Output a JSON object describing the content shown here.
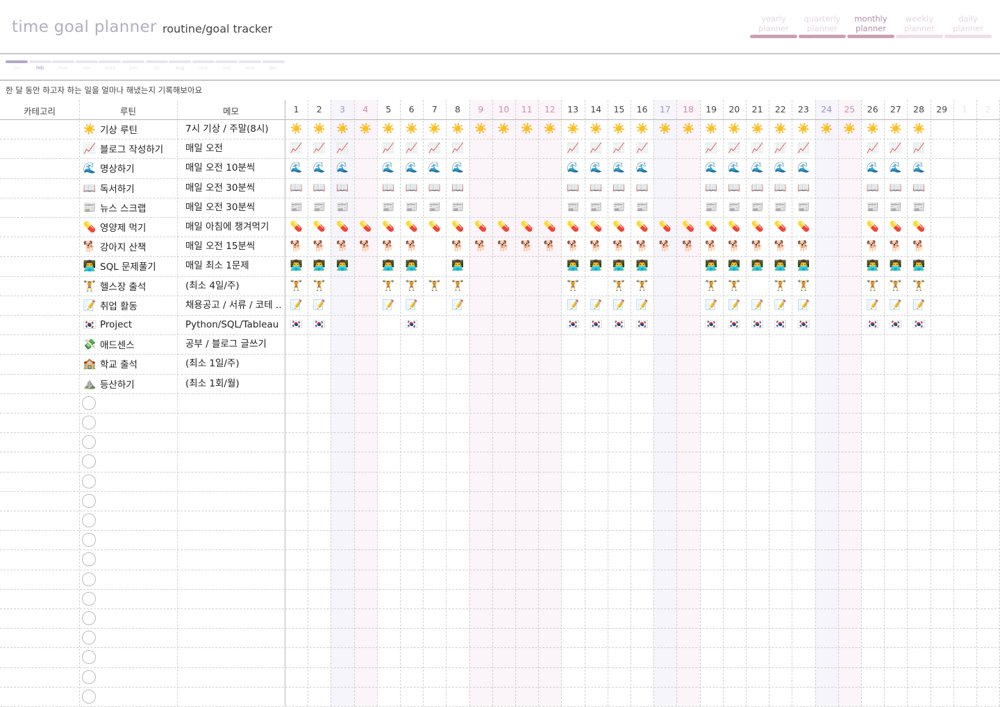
{
  "header": {
    "app_title": "time goal planner",
    "subtitle": "routine/goal tracker",
    "nav": [
      {
        "line1": "yearly",
        "line2": "planner",
        "state": "past"
      },
      {
        "line1": "quarterly",
        "line2": "planner",
        "state": "past"
      },
      {
        "line1": "monthly",
        "line2": "planner",
        "state": "active"
      },
      {
        "line1": "weekly",
        "line2": "planner",
        "state": "future"
      },
      {
        "line1": "daily",
        "line2": "planner",
        "state": "future"
      }
    ]
  },
  "months": [
    {
      "label": "jan",
      "state": "done"
    },
    {
      "label": "feb",
      "state": "current"
    },
    {
      "label": "mar",
      "state": "future"
    },
    {
      "label": "apr",
      "state": "future"
    },
    {
      "label": "may",
      "state": "future"
    },
    {
      "label": "jun",
      "state": "future"
    },
    {
      "label": "jul",
      "state": "future"
    },
    {
      "label": "aug",
      "state": "future"
    },
    {
      "label": "sep",
      "state": "future"
    },
    {
      "label": "oct",
      "state": "future"
    },
    {
      "label": "nov",
      "state": "future"
    },
    {
      "label": "dec",
      "state": "future"
    }
  ],
  "instruction": "한 달 동안 하고자 하는 일을 얼마나 해냈는지 기록해보아요",
  "columns": {
    "category": "카테고리",
    "routine": "루틴",
    "memo": "메모"
  },
  "days": [
    {
      "label": "1",
      "kind": "weekday"
    },
    {
      "label": "2",
      "kind": "weekday"
    },
    {
      "label": "3",
      "kind": "sat"
    },
    {
      "label": "4",
      "kind": "sun"
    },
    {
      "label": "5",
      "kind": "weekday"
    },
    {
      "label": "6",
      "kind": "weekday"
    },
    {
      "label": "7",
      "kind": "weekday"
    },
    {
      "label": "8",
      "kind": "weekday"
    },
    {
      "label": "9",
      "kind": "holiday"
    },
    {
      "label": "10",
      "kind": "holiday"
    },
    {
      "label": "11",
      "kind": "holiday"
    },
    {
      "label": "12",
      "kind": "holiday"
    },
    {
      "label": "13",
      "kind": "weekday"
    },
    {
      "label": "14",
      "kind": "weekday"
    },
    {
      "label": "15",
      "kind": "weekday"
    },
    {
      "label": "16",
      "kind": "weekday"
    },
    {
      "label": "17",
      "kind": "sat"
    },
    {
      "label": "18",
      "kind": "sun"
    },
    {
      "label": "19",
      "kind": "weekday"
    },
    {
      "label": "20",
      "kind": "weekday"
    },
    {
      "label": "21",
      "kind": "weekday"
    },
    {
      "label": "22",
      "kind": "weekday"
    },
    {
      "label": "23",
      "kind": "weekday"
    },
    {
      "label": "24",
      "kind": "sat"
    },
    {
      "label": "25",
      "kind": "sun"
    },
    {
      "label": "26",
      "kind": "weekday"
    },
    {
      "label": "27",
      "kind": "weekday"
    },
    {
      "label": "28",
      "kind": "weekday"
    },
    {
      "label": "29",
      "kind": "weekday"
    },
    {
      "label": "1",
      "kind": "next"
    },
    {
      "label": "2",
      "kind": "next"
    }
  ],
  "colors": {
    "sat_text": "#9c95c8",
    "sun_text": "#c890b4",
    "holiday_text": "#c890b4",
    "next_text": "#e6e6e6",
    "sat_bg": "#f6f5fb",
    "sun_bg": "#fbf4f8"
  },
  "routines": [
    {
      "icon": "☀️",
      "name": "기상 루틴",
      "memo": "7시 기상 / 주말(8시)",
      "done": [
        1,
        2,
        3,
        4,
        5,
        6,
        7,
        8,
        9,
        10,
        11,
        12,
        13,
        14,
        15,
        16,
        17,
        18,
        19,
        20,
        21,
        22,
        23,
        24,
        25,
        26,
        27,
        28
      ]
    },
    {
      "icon": "📈",
      "name": "블로그 작성하기",
      "memo": "매일 오전",
      "done": [
        1,
        2,
        3,
        5,
        6,
        7,
        8,
        13,
        14,
        15,
        16,
        19,
        20,
        21,
        22,
        23,
        26,
        27,
        28
      ]
    },
    {
      "icon": "🌊",
      "name": "명상하기",
      "memo": "매일 오전 10분씩",
      "done": [
        1,
        2,
        3,
        5,
        6,
        7,
        8,
        13,
        14,
        15,
        16,
        19,
        20,
        21,
        22,
        23,
        26,
        27,
        28
      ]
    },
    {
      "icon": "📖",
      "name": "독서하기",
      "memo": "매일 오전 30분씩",
      "done": [
        1,
        2,
        3,
        5,
        6,
        7,
        8,
        13,
        14,
        15,
        16,
        19,
        20,
        21,
        22,
        23,
        26,
        27,
        28
      ]
    },
    {
      "icon": "📰",
      "name": "뉴스 스크랩",
      "memo": "매일 오전 30분씩",
      "done": [
        1,
        2,
        3,
        5,
        6,
        7,
        8,
        13,
        14,
        15,
        16,
        19,
        20,
        21,
        22,
        23,
        26,
        27,
        28
      ]
    },
    {
      "icon": "💊",
      "name": "영양제 먹기",
      "memo": "매일 아침에 챙겨먹기",
      "done": [
        1,
        2,
        3,
        4,
        5,
        6,
        7,
        8,
        9,
        10,
        11,
        12,
        13,
        14,
        15,
        16,
        17,
        18,
        19,
        20,
        21,
        22,
        23,
        26,
        27,
        28
      ]
    },
    {
      "icon": "🐕",
      "name": "강아지 산책",
      "memo": "매일 오전 15분씩",
      "done": [
        1,
        2,
        3,
        4,
        5,
        6,
        8,
        9,
        10,
        11,
        12,
        13,
        14,
        15,
        16,
        17,
        18,
        19,
        20,
        21,
        22,
        23,
        26,
        27,
        28
      ]
    },
    {
      "icon": "👨‍💻",
      "name": "SQL 문제풀기",
      "memo": "매일 최소 1문제",
      "done": [
        1,
        2,
        3,
        5,
        6,
        8,
        13,
        14,
        15,
        16,
        19,
        20,
        21,
        22,
        23,
        26,
        27,
        28
      ]
    },
    {
      "icon": "🏋️",
      "name": "헬스장 출석",
      "memo": "(최소 4일/주)",
      "done": [
        1,
        2,
        5,
        6,
        7,
        8,
        13,
        15,
        16,
        19,
        20,
        22,
        23,
        26,
        27,
        28
      ]
    },
    {
      "icon": "📝",
      "name": "취업 활동",
      "memo": "채용공고 / 서류 / 코테 ..",
      "done": [
        1,
        2,
        5,
        6,
        8,
        13,
        14,
        15,
        16,
        19,
        20,
        21,
        22,
        23,
        26,
        27,
        28
      ]
    },
    {
      "icon": "🇰🇷",
      "name": "Project",
      "memo": "Python/SQL/Tableau",
      "done": [
        1,
        2,
        6,
        13,
        14,
        15,
        16,
        19,
        20,
        21,
        22,
        23,
        26,
        27,
        28
      ]
    },
    {
      "icon": "💸",
      "name": "애드센스",
      "memo": "공부 / 블로그 글쓰기",
      "done": []
    },
    {
      "icon": "🏫",
      "name": "학교 출석",
      "memo": "(최소 1일/주)",
      "done": []
    },
    {
      "icon": "⛰️",
      "name": "등산하기",
      "memo": "(최소 1회/월)",
      "done": []
    }
  ],
  "empty_rows": 16
}
